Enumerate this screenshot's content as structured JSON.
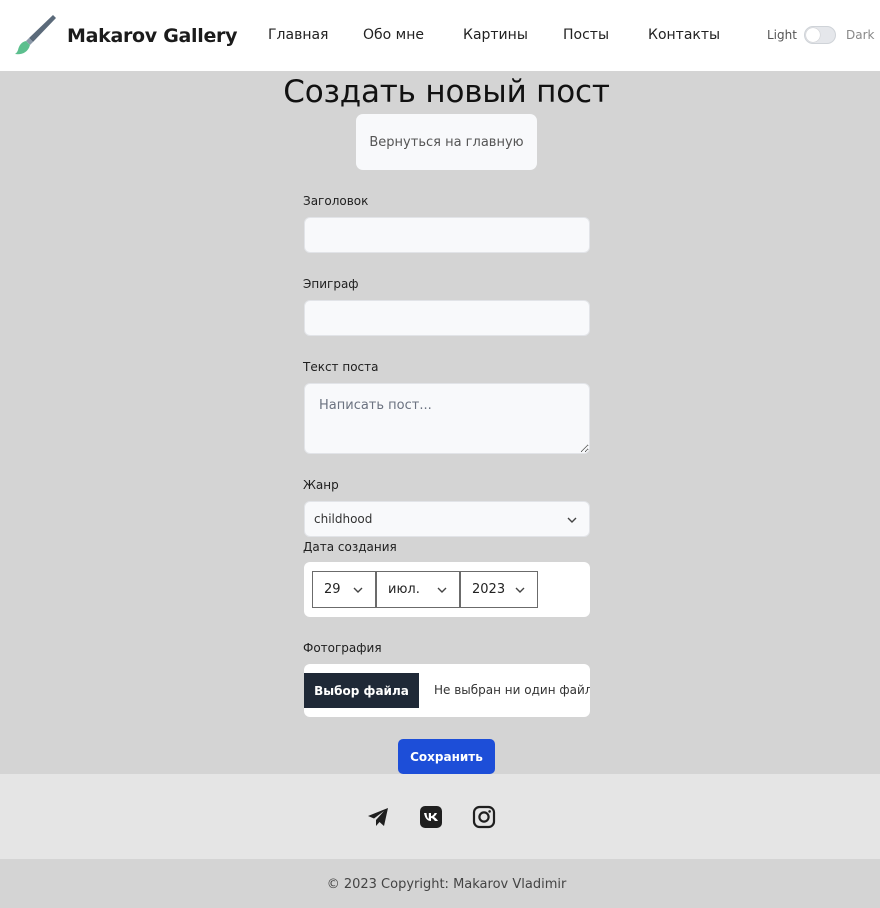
{
  "navbar": {
    "brand": "Makarov Gallery",
    "links": [
      "Главная",
      "Обо мне",
      "Картины",
      "Посты",
      "Контакты"
    ],
    "theme_light": "Light",
    "theme_dark": "Dark"
  },
  "main": {
    "title": "Создать новый пост",
    "back_button": "Вернуться на главную",
    "fields": {
      "title_label": "Заголовок",
      "title_value": "",
      "epigraph_label": "Эпиграф",
      "epigraph_value": "",
      "text_label": "Текст поста",
      "text_placeholder": "Написать пост...",
      "genre_label": "Жанр",
      "genre_value": "childhood",
      "date_label": "Дата создания",
      "date": {
        "day": "29",
        "month": "июл.",
        "year": "2023"
      },
      "photo_label": "Фотография",
      "file_button": "Выбор файла",
      "file_status": "Не выбран ни один файл"
    },
    "save_button": "Сохранить"
  },
  "footer": {
    "social_icons": [
      "telegram-icon",
      "vk-icon",
      "instagram-icon"
    ],
    "copyright": "© 2023 Copyright: Makarov Vladimir"
  },
  "colors": {
    "accent": "#1d4ed8",
    "file_button_bg": "#1f2937",
    "page_bg": "#d4d4d4",
    "footer_bg": "#e5e5e5"
  }
}
